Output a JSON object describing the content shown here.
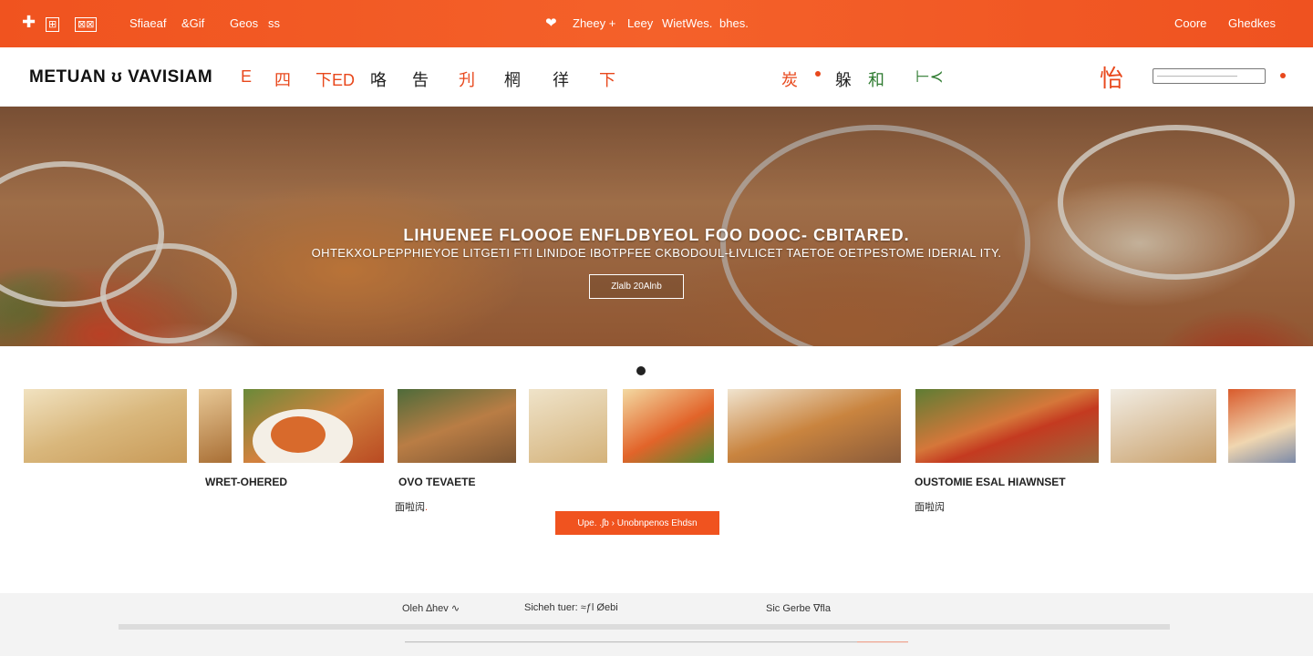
{
  "colors": {
    "accent": "#f0531f",
    "text": "#222222",
    "footer_bg": "#f3f3f3",
    "green": "#2d7a2f"
  },
  "topbar": {
    "left": [
      {
        "icon": "plus-icon",
        "label": "✚"
      },
      {
        "label": "⊞"
      },
      {
        "label": "⊠⊠"
      },
      {
        "label": "Sfiaeaf"
      },
      {
        "label": "&Gif"
      },
      {
        "label": "Geos"
      },
      {
        "label": "ss"
      }
    ],
    "center": [
      {
        "icon": "heart-icon",
        "label": "❤"
      },
      {
        "label": "Zheey +"
      },
      {
        "label": "Leey"
      },
      {
        "label": "WietWes."
      },
      {
        "label": "bhes."
      }
    ],
    "right": [
      {
        "label": "Coore"
      },
      {
        "label": "Ghedkes"
      }
    ]
  },
  "nav": {
    "brand": "METUAN ʊ VAVISIAM",
    "items": [
      "E",
      "四",
      "下ED",
      "咯",
      "吿",
      "刋",
      "棢",
      "徉",
      "下"
    ],
    "right_items": [
      "炭",
      "躲",
      "和",
      "⊢≺"
    ],
    "logo_glyph": "怡",
    "search_placeholder": "———————————"
  },
  "hero": {
    "title": "LIHUENEE FLOOOE ENFLDBYEOL FOO DOOC- CBITARED.",
    "subtitle": "OHTEKXOLPEPPHIEYOE LITGETI FTI LINIDOE IBOTPFEE CKBODOUL-ŁIVLICET TAETOE OETPESTOME IDERIAL ITY.",
    "button": "Zlalb 20Alnb"
  },
  "carousel": {
    "cards": [
      {
        "title": "WRET-OHERED",
        "meta": ""
      },
      {
        "title": "OVO TEVAETE",
        "meta": "面啦闶",
        "meta_accent": "."
      },
      {
        "title": "OUSTOMIE ESAL HIAWNSET",
        "meta": "面啦闶"
      }
    ],
    "cta": "Upe. .ʃb › Unobnpenos Ehdsn"
  },
  "footer": {
    "links": [
      "Oleh  ∆hev  ∿",
      "Sicheh  tuer: ≈ƒl  Øebi",
      "Sic  Gerbe  ∇fla"
    ],
    "small": "——————————————————————————————————————————————————————————————",
    "small_accent": "———————"
  }
}
